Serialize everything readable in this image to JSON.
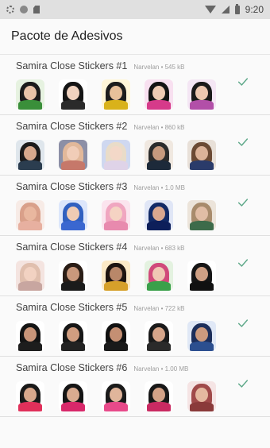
{
  "status_bar": {
    "time": "9:20"
  },
  "app_bar": {
    "title": "Pacote de Adesivos"
  },
  "packs": [
    {
      "name": "Samira Close Stickers #1",
      "publisher": "Narvelan",
      "size": "545 kB",
      "stickers": [
        {
          "hair": "#1b1b1b",
          "face": "#e8c3a8",
          "body": "#3a8f3a",
          "bg": "#e6f2e0"
        },
        {
          "hair": "#151515",
          "face": "#f0d2bf",
          "body": "#2a2a2a",
          "bg": "#ffffff"
        },
        {
          "hair": "#1d1d1d",
          "face": "#e8c09a",
          "body": "#d9b21a",
          "bg": "#fff6d8"
        },
        {
          "hair": "#141414",
          "face": "#efcbb4",
          "body": "#d63a8a",
          "bg": "#f8e0f0"
        },
        {
          "hair": "#1a1a1a",
          "face": "#ecc7b0",
          "body": "#b24fa8",
          "bg": "#f4e6f4"
        }
      ]
    },
    {
      "name": "Samira Close Stickers #2",
      "publisher": "Narvelan",
      "size": "860 kB",
      "stickers": [
        {
          "hair": "#1b1b1b",
          "face": "#d7a98d",
          "body": "#2b3d4f",
          "bg": "#dfe6ec"
        },
        {
          "hair": "#e2b89a",
          "face": "#f1cdb8",
          "body": "#c6786a",
          "bg": "#8c8fa6"
        },
        {
          "hair": "#e9dcc8",
          "face": "#f3d8c8",
          "body": "#dfd3e8",
          "bg": "#cfd8f0"
        },
        {
          "hair": "#2b2b2b",
          "face": "#c79a7e",
          "body": "#1d2a3a",
          "bg": "#f0e8e0"
        },
        {
          "hair": "#6b4a34",
          "face": "#dcb399",
          "body": "#2a3b6a",
          "bg": "#e8e0d8"
        }
      ]
    },
    {
      "name": "Samira Close Stickers #3",
      "publisher": "Narvelan",
      "size": "1.0 MB",
      "stickers": [
        {
          "hair": "#d9a08a",
          "face": "#e9b79f",
          "body": "#e7b0a0",
          "bg": "#f7ebe6"
        },
        {
          "hair": "#3060c0",
          "face": "#efcbb4",
          "body": "#3a67d0",
          "bg": "#dce6fb"
        },
        {
          "hair": "#f0a6c0",
          "face": "#f5d3c3",
          "body": "#e88aae",
          "bg": "#fbe4ee"
        },
        {
          "hair": "#122a66",
          "face": "#d9a78f",
          "body": "#0d1f5a",
          "bg": "#e0e6f6"
        },
        {
          "hair": "#a88b6c",
          "face": "#e1bda5",
          "body": "#3d6b4a",
          "bg": "#ece4da"
        }
      ]
    },
    {
      "name": "Samira Close Stickers #4",
      "publisher": "Narvelan",
      "size": "683 kB",
      "stickers": [
        {
          "hair": "#e0bfae",
          "face": "#f2d2c2",
          "body": "#c8a6a0",
          "bg": "#f4e4e0"
        },
        {
          "hair": "#2a1d16",
          "face": "#c9987c",
          "body": "#1b1b1b",
          "bg": "#ffffff"
        },
        {
          "hair": "#1e1410",
          "face": "#b98769",
          "body": "#d6a02a",
          "bg": "#fbe9c6"
        },
        {
          "hair": "#d04a7a",
          "face": "#f0c8b4",
          "body": "#3aa04a",
          "bg": "#e4f2e0"
        },
        {
          "hair": "#161616",
          "face": "#cfa084",
          "body": "#111111",
          "bg": "#ffffff"
        }
      ]
    },
    {
      "name": "Samira Close Stickers #5",
      "publisher": "Narvelan",
      "size": "722 kB",
      "stickers": [
        {
          "hair": "#141414",
          "face": "#c99579",
          "body": "#1d1d1d",
          "bg": "#ffffff"
        },
        {
          "hair": "#161616",
          "face": "#d09d80",
          "body": "#222222",
          "bg": "#ffffff"
        },
        {
          "hair": "#111111",
          "face": "#c48f73",
          "body": "#1a1a1a",
          "bg": "#ffffff"
        },
        {
          "hair": "#1a1a1a",
          "face": "#d6a58a",
          "body": "#2a2a2a",
          "bg": "#ffffff"
        },
        {
          "hair": "#1c2e5a",
          "face": "#cc9a7e",
          "body": "#2c4f8f",
          "bg": "#e0e8f6"
        }
      ]
    },
    {
      "name": "Samira Close Stickers #6",
      "publisher": "Narvelan",
      "size": "1.00 MB",
      "stickers": [
        {
          "hair": "#1a1a1a",
          "face": "#d8a88c",
          "body": "#e0305a",
          "bg": "#ffffff"
        },
        {
          "hair": "#151515",
          "face": "#d9ab90",
          "body": "#d8286a",
          "bg": "#ffffff"
        },
        {
          "hair": "#1b1b1b",
          "face": "#e0b59b",
          "body": "#e84a8a",
          "bg": "#ffffff"
        },
        {
          "hair": "#181818",
          "face": "#d3a287",
          "body": "#c92a62",
          "bg": "#ffffff"
        },
        {
          "hair": "#a04a4a",
          "face": "#e5b9a0",
          "body": "#8a3a3a",
          "bg": "#f5e4e4"
        }
      ]
    }
  ],
  "colors": {
    "accent": "#4caf50",
    "check": "#5fa98a"
  },
  "icons": {
    "status_left": [
      "gear-icon",
      "circle-icon",
      "sdcard-icon"
    ],
    "status_right": [
      "wifi-icon",
      "signal-icon",
      "battery-icon"
    ],
    "pack_added": "check-icon"
  }
}
